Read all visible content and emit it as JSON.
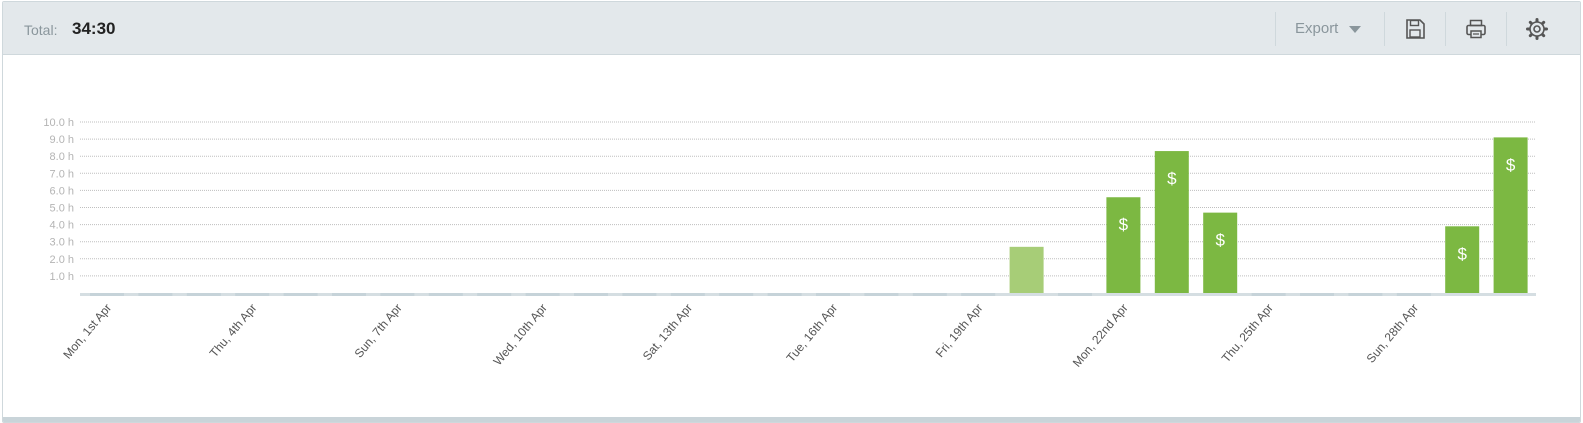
{
  "toolbar": {
    "total_label": "Total:",
    "total_value": "34:30",
    "export_label": "Export",
    "icons": [
      "save-icon",
      "print-icon",
      "settings-icon"
    ]
  },
  "colors": {
    "bar_billable": "#7cb842",
    "bar_nonbillable": "#a7cd77",
    "empty_marker": "#c6d3d9",
    "grid": "#bfbfbf",
    "tick_text": "#b4b4b4",
    "label_text": "#555555"
  },
  "chart_data": {
    "type": "bar",
    "unit": "h",
    "ylim": [
      0,
      10
    ],
    "yticks": [
      "1.0 h",
      "2.0 h",
      "3.0 h",
      "4.0 h",
      "5.0 h",
      "6.0 h",
      "7.0 h",
      "8.0 h",
      "9.0 h",
      "10.0 h"
    ],
    "grid": true,
    "bar_icon": "$",
    "x_labels": [
      "Mon, 1st Apr",
      "Thu, 4th Apr",
      "Sun, 7th Apr",
      "Wed, 10th Apr",
      "Sat, 13th Apr",
      "Tue, 16th Apr",
      "Fri, 19th Apr",
      "Mon, 22nd Apr",
      "Thu, 25th Apr",
      "Sun, 28th Apr"
    ],
    "label_every": 3,
    "values": [
      0,
      0,
      0,
      0,
      0,
      0,
      0,
      0,
      0,
      0,
      0,
      0,
      0,
      0,
      0,
      0,
      0,
      0,
      0,
      2.7,
      0,
      5.6,
      8.3,
      4.7,
      0,
      0,
      0,
      0,
      3.9,
      9.1
    ],
    "billable": [
      false,
      false,
      false,
      false,
      false,
      false,
      false,
      false,
      false,
      false,
      false,
      false,
      false,
      false,
      false,
      false,
      false,
      false,
      false,
      false,
      false,
      true,
      true,
      true,
      false,
      false,
      false,
      false,
      true,
      true
    ]
  }
}
